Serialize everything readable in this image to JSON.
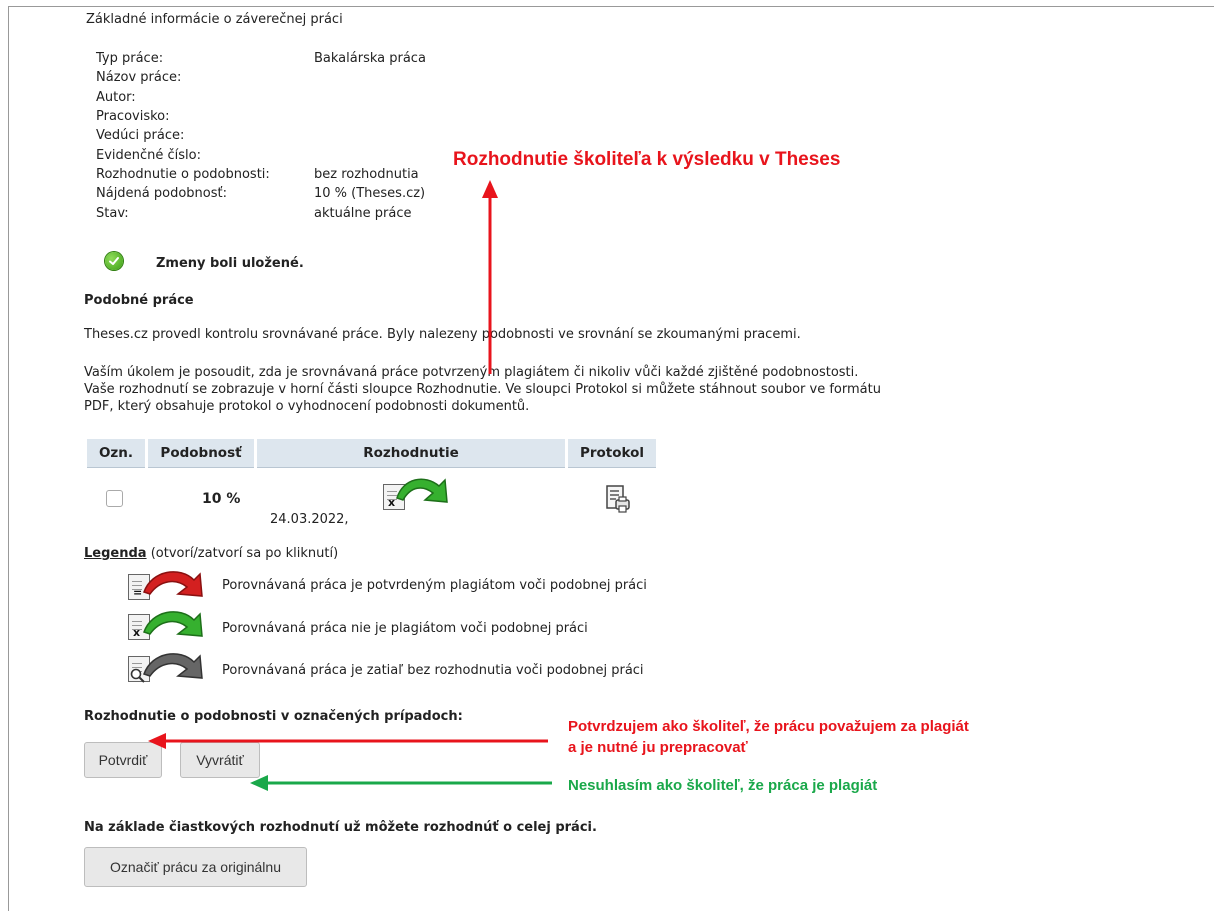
{
  "section_title": "Základné informácie o záverečnej práci",
  "info": [
    {
      "label": "Typ práce:",
      "value": "Bakalárska práca"
    },
    {
      "label": "Názov práce:",
      "value": ""
    },
    {
      "label": "Autor:",
      "value": ""
    },
    {
      "label": "Pracovisko:",
      "value": ""
    },
    {
      "label": "Vedúci práce:",
      "value": ""
    },
    {
      "label": "Evidenčné číslo:",
      "value": ""
    },
    {
      "label": "Rozhodnutie o podobnosti:",
      "value": "bez rozhodnutia"
    },
    {
      "label": "Nájdená podobnosť:",
      "value": "10 % (Theses.cz)"
    },
    {
      "label": "Stav:",
      "value": "aktuálne práce"
    }
  ],
  "success_message": "Zmeny boli uložené.",
  "similar_heading": "Podobné práce",
  "para1": "Theses.cz provedl kontrolu srovnávané práce. Byly nalezeny podobnosti ve srovnání se zkoumanými pracemi.",
  "para2": [
    "Vaším úkolem je posoudit, zda je srovnávaná práce potvrzeným plagiátem či nikoliv vůči každé zjištěné podobnostosti.",
    "Vaše rozhodnutí se zobrazuje v horní části sloupce Rozhodnutie. Ve sloupci Protokol si můžete stáhnout soubor ve formátu",
    "PDF, který obsahuje protokol o vyhodnocení podobnosti dokumentů."
  ],
  "table": {
    "headers": [
      "Ozn.",
      "Podobnosť",
      "Rozhodnutie",
      "Protokol"
    ],
    "row": {
      "similarity": "10 %",
      "date": "24.03.2022,"
    }
  },
  "legend": {
    "link": "Legenda",
    "hint": "(otvorí/zatvorí sa po kliknutí)",
    "items": [
      {
        "icon": "doc-confirmed-plagiarism-icon",
        "color": "#d32020",
        "text": "Porovnávaná práca je potvrdeným plagiátom voči podobnej práci"
      },
      {
        "icon": "doc-not-plagiarism-icon",
        "color": "#2fa82c",
        "text": "Porovnávaná práca nie je plagiátom voči podobnej práci"
      },
      {
        "icon": "doc-undecided-icon",
        "color": "#555555",
        "text": "Porovnávaná práca je zatiaľ bez rozhodnutia voči podobnej práci"
      }
    ]
  },
  "decision_heading": "Rozhodnutie o podobnosti v označených prípadoch:",
  "buttons": {
    "confirm": "Potvrdiť",
    "refute": "Vyvrátiť",
    "mark_original": "Označiť prácu za originálnu"
  },
  "whole_heading": "Na základe čiastkových rozhodnutí už môžete rozhodnúť o celej práci.",
  "annotations": {
    "top": "Rozhodnutie školiteľa k výsledku v Theses",
    "confirm_line1": "Potvrdzujem ako školiteľ, že prácu považujem za plagiát",
    "confirm_line2": "a je nutné ju prepracovať",
    "refute": "Nesuhlasím ako školiteľ, že práca je plagiát"
  },
  "colors": {
    "annotation_red": "#e8141c",
    "annotation_green": "#1aa84a",
    "table_header": "#dde6ee",
    "button": "#e8e8e8"
  }
}
